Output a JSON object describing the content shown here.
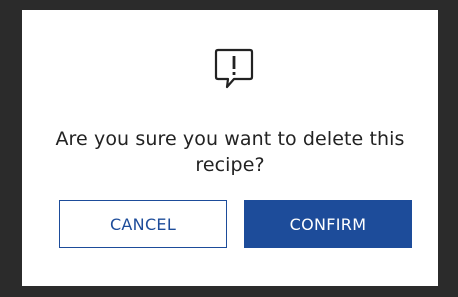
{
  "dialog": {
    "icon": "alert-speech-bubble-icon",
    "message_line1": "Are you sure you want to delete this",
    "message_line2": "recipe?",
    "cancel_label": "CANCEL",
    "confirm_label": "CONFIRM"
  },
  "colors": {
    "accent": "#1d4c9a",
    "backdrop": "#2b2b2b",
    "dialog_bg": "#ffffff",
    "text": "#222222"
  }
}
